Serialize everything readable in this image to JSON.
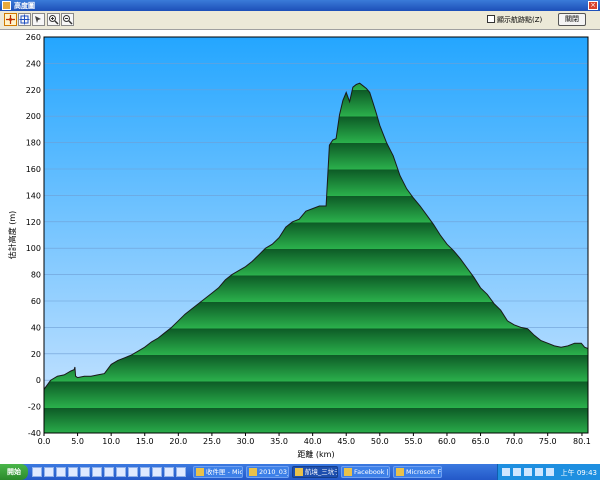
{
  "window": {
    "title": "高度圖",
    "show_route_label": "顯示航跡點(Z)",
    "close_label": "關閉",
    "show_route_checked": false
  },
  "toolbar": {
    "icons": [
      "pointer-tool-icon",
      "pan-tool-icon",
      "select-tool-icon",
      "zoom-in-icon",
      "zoom-out-icon"
    ]
  },
  "colors": {
    "sky_top": "#24a6ff",
    "sky_bottom": "#cfe6ff",
    "terrain_dark": "#0d5a26",
    "terrain_light": "#2bb14c",
    "outline": "#1a1a1a"
  },
  "chart_data": {
    "type": "area",
    "title": "",
    "xlabel": "距離   (km)",
    "ylabel": "估計高度 (m)",
    "xlim": [
      0,
      81
    ],
    "ylim": [
      -40,
      260
    ],
    "xticks": [
      "0.0",
      "5.0",
      "10.0",
      "15.0",
      "20.0",
      "25.0",
      "30.0",
      "35.0",
      "40.0",
      "45.0",
      "50.0",
      "55.0",
      "60.0",
      "65.0",
      "70.0",
      "75.0",
      "80.1"
    ],
    "yticks": [
      "260",
      "240",
      "220",
      "200",
      "180",
      "160",
      "140",
      "120",
      "100",
      "80",
      "60",
      "40",
      "20",
      "0",
      "-20",
      "-40"
    ],
    "grid": true,
    "series": [
      {
        "x": [
          0,
          1,
          2,
          3,
          4,
          4.5,
          4.6,
          4.7,
          5,
          6,
          7,
          8,
          9,
          10,
          11,
          12,
          13,
          14,
          15,
          16,
          17,
          18,
          19,
          20,
          21,
          22,
          23,
          24,
          25,
          26,
          27,
          28,
          29,
          30,
          31,
          32,
          33,
          34,
          35,
          36,
          37,
          38,
          39,
          40,
          41,
          42,
          42.5,
          43,
          43.5,
          44,
          44.5,
          45,
          45.5,
          46,
          46.5,
          47,
          47.5,
          48,
          48.5,
          49,
          49.5,
          50,
          51,
          52,
          53,
          54,
          55,
          56,
          57,
          58,
          59,
          60,
          61,
          62,
          63,
          64,
          65,
          66,
          67,
          68,
          69,
          70,
          71,
          72,
          73,
          74,
          75,
          76,
          77,
          78,
          79,
          80,
          80.5,
          81
        ],
        "values": [
          -7,
          0,
          3,
          4,
          7,
          8,
          10,
          3,
          2,
          3,
          3,
          4,
          5,
          12,
          15,
          17,
          19,
          22,
          25,
          29,
          32,
          36,
          40,
          45,
          50,
          54,
          58,
          62,
          66,
          70,
          76,
          80,
          83,
          86,
          90,
          95,
          100,
          103,
          108,
          116,
          120,
          122,
          128,
          130,
          132,
          132,
          178,
          182,
          183,
          201,
          212,
          218,
          211,
          222,
          224,
          225,
          223,
          221,
          218,
          210,
          202,
          193,
          180,
          170,
          155,
          145,
          138,
          132,
          125,
          118,
          110,
          103,
          98,
          92,
          85,
          78,
          70,
          65,
          58,
          53,
          45,
          42,
          40,
          39,
          34,
          30,
          28,
          26,
          25,
          26,
          28,
          28,
          25,
          24
        ]
      }
    ]
  },
  "taskbar": {
    "start_label": "開始",
    "tasks": [
      "收件匣 - Mic...",
      "2010_03_13...",
      "航境_三坑子...",
      "Facebook | 我...",
      "Microsoft Fo..."
    ],
    "active_task_index": 2,
    "clock": "上午 09:43"
  }
}
